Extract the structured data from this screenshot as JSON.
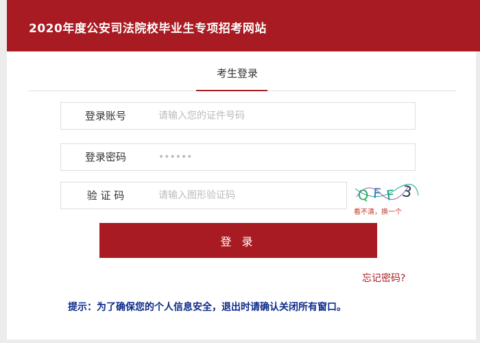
{
  "header": {
    "title": "2020年度公安司法院校毕业生专项招考网站",
    "background": "#a91b22"
  },
  "tabs": [
    {
      "label": "考生登录",
      "active": true
    }
  ],
  "form": {
    "account": {
      "label": "登录账号",
      "placeholder": "请输入您的证件号码",
      "value": ""
    },
    "password": {
      "label": "登录密码",
      "value": "••••••"
    },
    "captcha": {
      "label": "验 证 码",
      "placeholder": "请输入图形验证码",
      "value": "",
      "image_text": "QFF3",
      "hint": "看不清，换一个"
    },
    "submit_label": "登 录",
    "forgot_label": "忘记密码?"
  },
  "notice": "提示：为了确保您的个人信息安全，退出时请确认关闭所有窗口。",
  "colors": {
    "primary": "#a91b22",
    "notice": "#0d2a8a",
    "background": "#ececec"
  }
}
